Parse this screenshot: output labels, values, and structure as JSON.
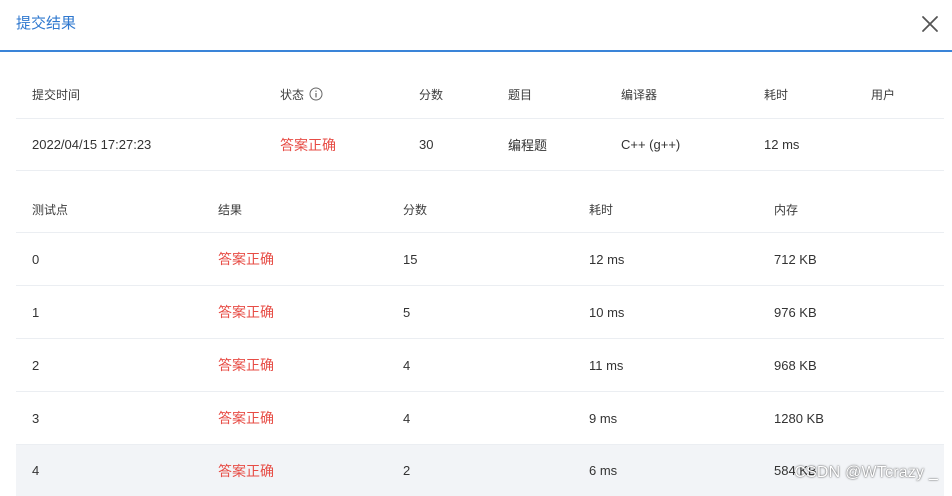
{
  "dialog": {
    "title": "提交结果",
    "close_icon": "close-icon"
  },
  "summary": {
    "headers": [
      "提交时间",
      "状态",
      "分数",
      "题目",
      "编译器",
      "耗时",
      "用户"
    ],
    "row": [
      "2022/04/15 17:27:23",
      "答案正确",
      "30",
      "编程题",
      "C++ (g++)",
      "12 ms",
      ""
    ],
    "status_color": "#e74c45"
  },
  "testcases": {
    "headers": [
      "测试点",
      "结果",
      "分数",
      "耗时",
      "内存"
    ],
    "rows": [
      [
        "0",
        "答案正确",
        "15",
        "12 ms",
        "712 KB"
      ],
      [
        "1",
        "答案正确",
        "5",
        "10 ms",
        "976 KB"
      ],
      [
        "2",
        "答案正确",
        "4",
        "11 ms",
        "968 KB"
      ],
      [
        "3",
        "答案正确",
        "4",
        "9 ms",
        "1280 KB"
      ],
      [
        "4",
        "答案正确",
        "2",
        "6 ms",
        "584 KB"
      ]
    ]
  },
  "watermark": "CSDN @WTcrazy _",
  "colors": {
    "accent": "#2f78cf",
    "header_rule": "#3a84d8",
    "row_highlight": "#f2f4f7"
  }
}
